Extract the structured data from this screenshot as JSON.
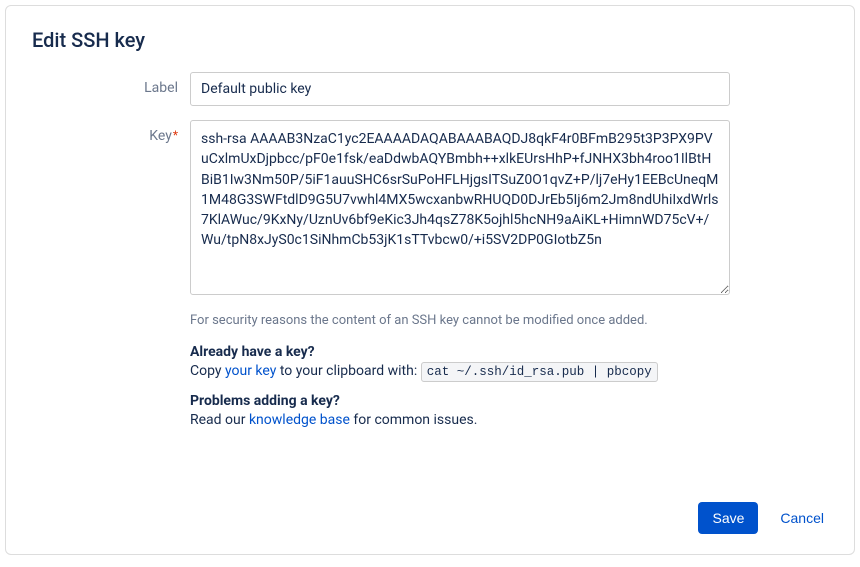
{
  "dialog": {
    "title": "Edit SSH key"
  },
  "form": {
    "label_field": {
      "label": "Label",
      "value": "Default public key"
    },
    "key_field": {
      "label": "Key",
      "required_mark": "*",
      "value": "ssh-rsa AAAAB3NzaC1yc2EAAAADAQABAAABAQDJ8qkF4r0BFmB295t3P3PX9PVuCxlmUxDjpbcc/pF0e1fsk/eaDdwbAQYBmbh++xlkEUrsHhP+fJNHX3bh4roo1IlBtHBiB1Iw3Nm50P/5iF1auuSHC6srSuPoHFLHjgsITSuZ0O1qvZ+P/lj7eHy1EEBcUneqM1M48G3SWFtdlD9G5U7vwhl4MX5wcxanbwRHUQD0DJrEb5Ij6m2Jm8ndUhiIxdWrls7KlAWuc/9KxNy/UznUv6bf9eKic3Jh4qsZ78K5ojhl5hcNH9aAiKL+HimnWD75cV+/Wu/tpN8xJyS0c1SiNhmCb53jK1sTTvbcw0/+i5SV2DP0GIotbZ5n"
    },
    "hint": "For security reasons the content of an SSH key cannot be modified once added.",
    "already_have": {
      "heading": "Already have a key?",
      "text_prefix": "Copy ",
      "link_text": "your key",
      "text_mid": " to your clipboard with: ",
      "command": "cat ~/.ssh/id_rsa.pub | pbcopy"
    },
    "problems": {
      "heading": "Problems adding a key?",
      "text_prefix": "Read our ",
      "link_text": "knowledge base",
      "text_suffix": " for common issues."
    }
  },
  "buttons": {
    "save": "Save",
    "cancel": "Cancel"
  }
}
